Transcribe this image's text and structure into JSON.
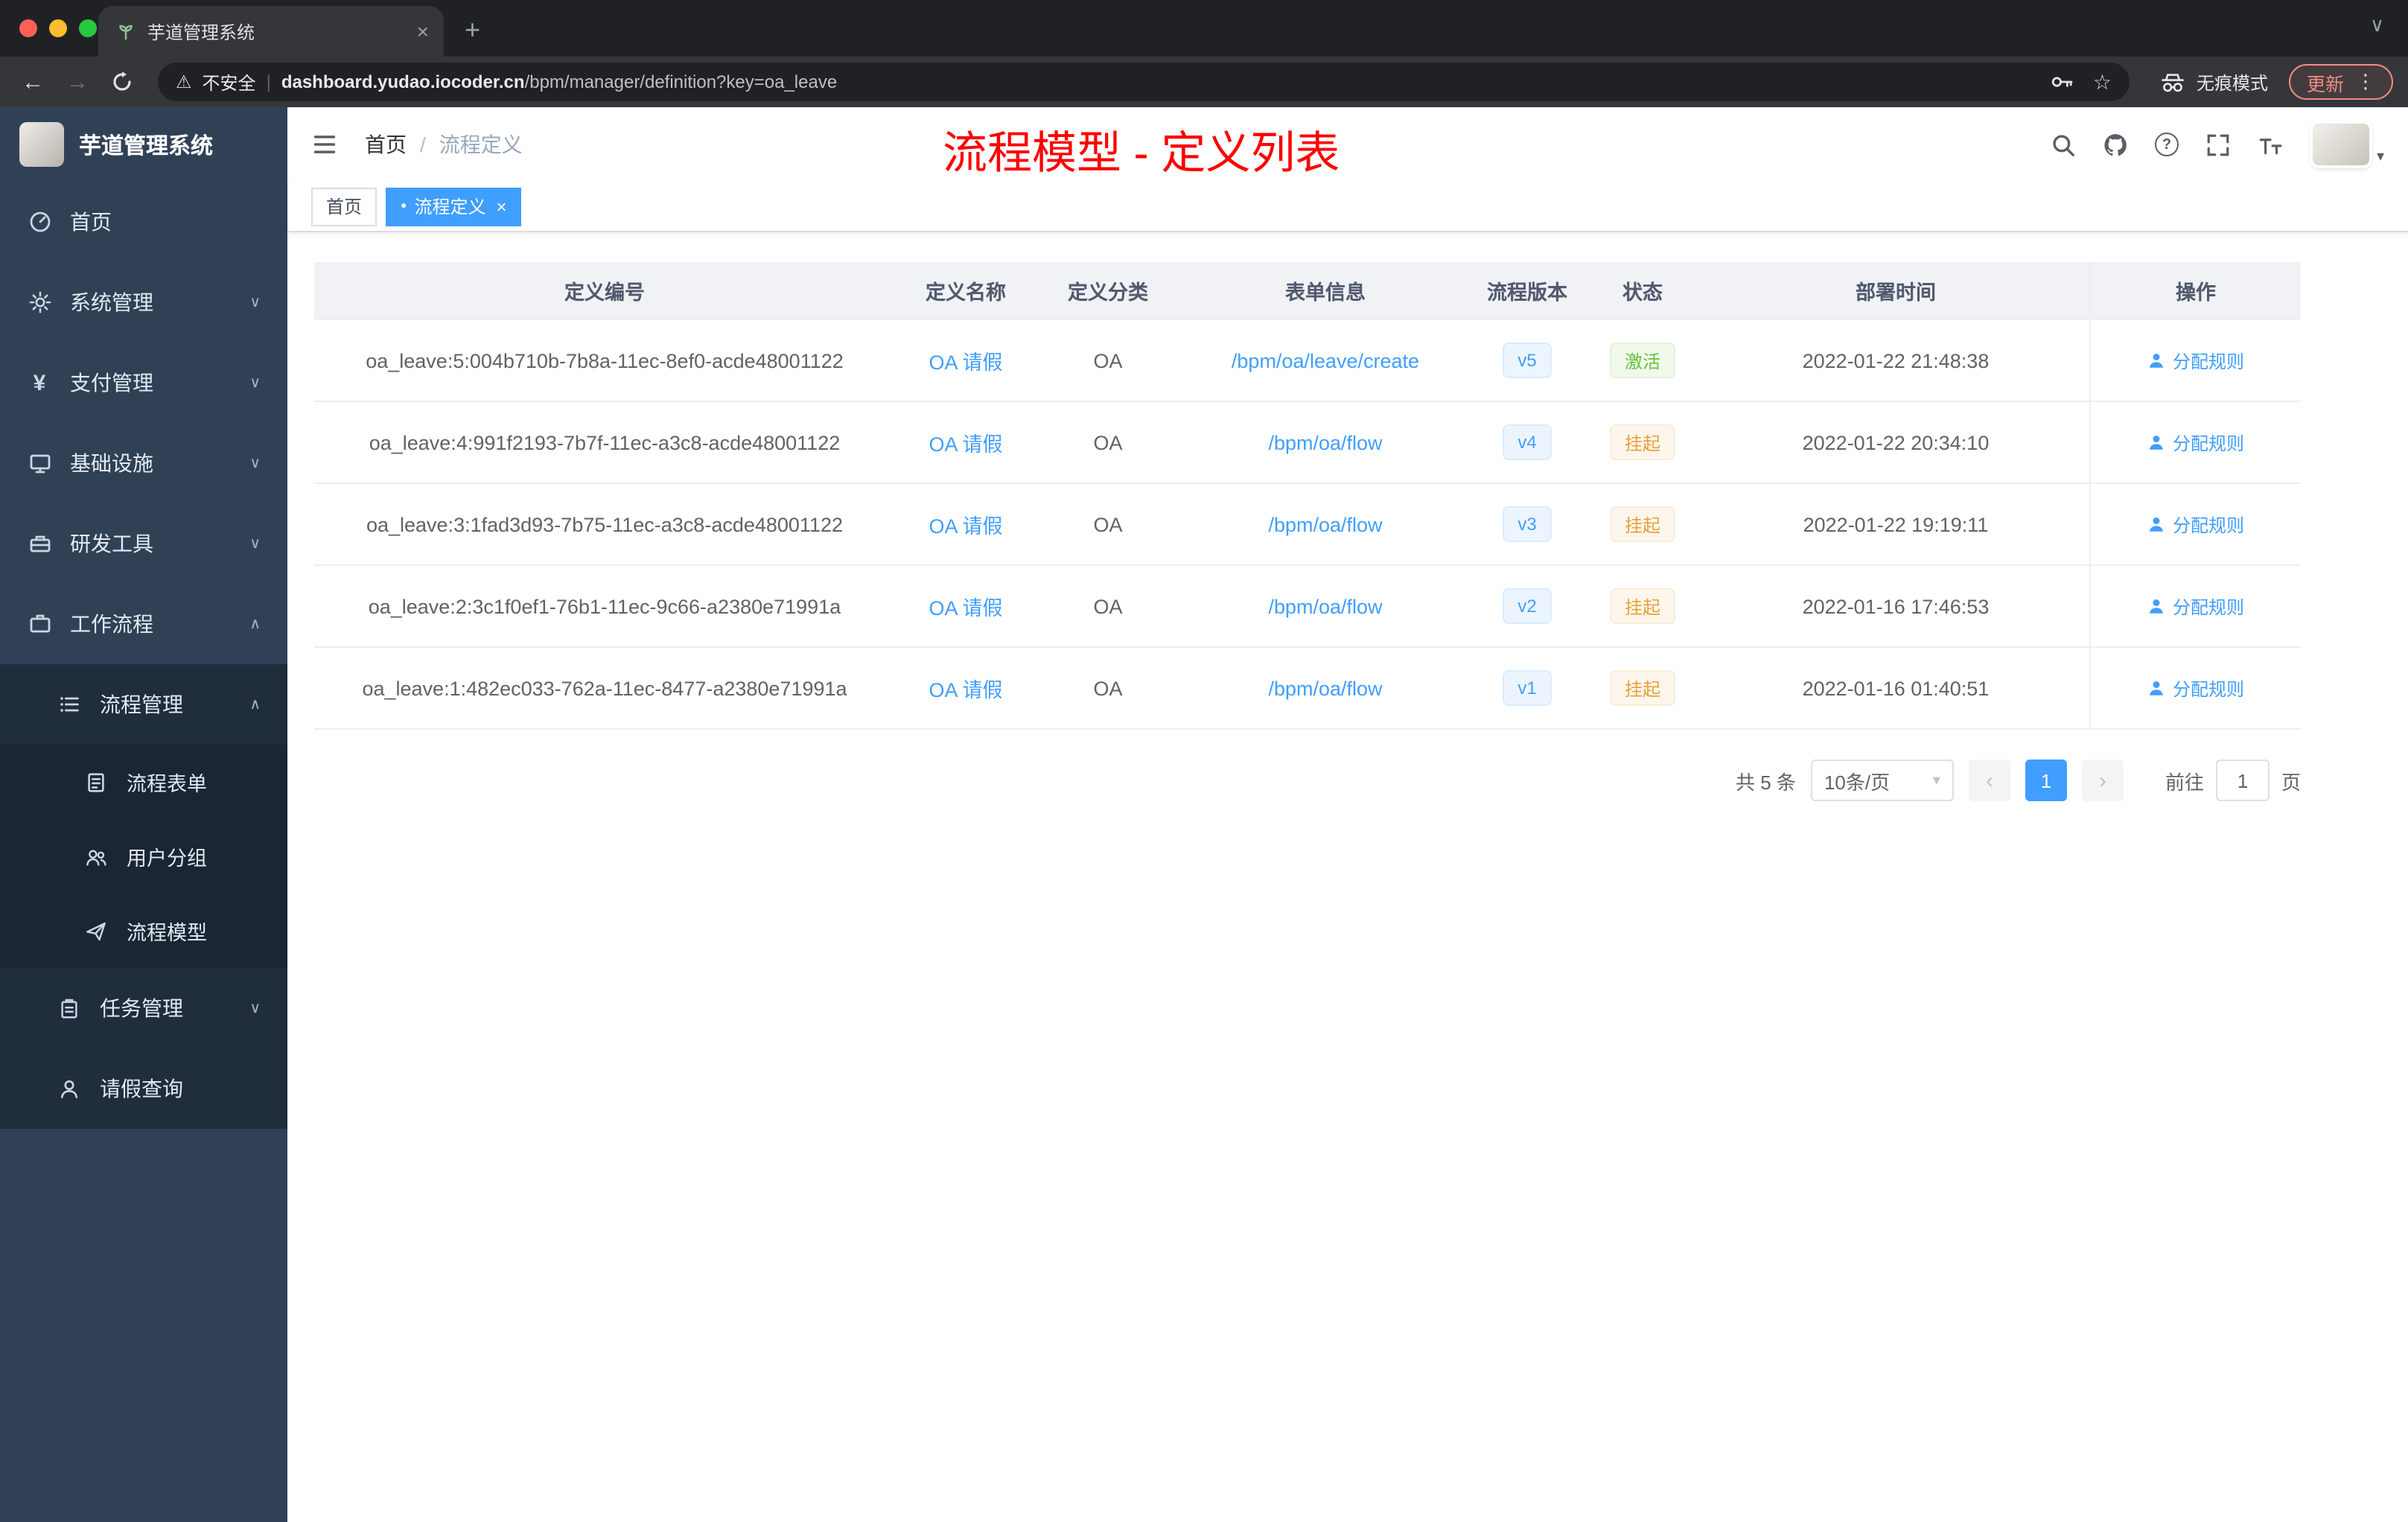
{
  "browser": {
    "tab_title": "芋道管理系统",
    "security_label": "不安全",
    "url_host": "dashboard.yudao.iocoder.cn",
    "url_path": "/bpm/manager/definition?key=oa_leave",
    "incognito_label": "无痕模式",
    "update_label": "更新"
  },
  "icons": {
    "back": "←",
    "forward": "→",
    "star": "☆",
    "warning": "⚠",
    "menu_dots": "⋮",
    "close": "×",
    "new_tab": "+",
    "tabs_chevron": "∨",
    "separator": "|",
    "avatar_caret": "▾",
    "select_caret": "▾",
    "pager_prev": "‹",
    "pager_next": "›",
    "breadcrumb_sep": "/",
    "tag_dot": "●",
    "yen": "¥",
    "chevron_down": "∨",
    "chevron_up": "∧"
  },
  "sidebar": {
    "logo_title": "芋道管理系统",
    "items": [
      {
        "label": "首页"
      },
      {
        "label": "系统管理"
      },
      {
        "label": "支付管理"
      },
      {
        "label": "基础设施"
      },
      {
        "label": "研发工具"
      },
      {
        "label": "工作流程"
      }
    ],
    "process_management": {
      "label": "流程管理"
    },
    "process_children": [
      {
        "label": "流程表单"
      },
      {
        "label": "用户分组"
      },
      {
        "label": "流程模型"
      }
    ],
    "task_management": {
      "label": "任务管理"
    },
    "leave_query": {
      "label": "请假查询"
    }
  },
  "header": {
    "breadcrumb_home": "首页",
    "breadcrumb_current": "流程定义",
    "annotation": "流程模型 - 定义列表"
  },
  "tags": [
    {
      "label": "首页"
    },
    {
      "label": "流程定义"
    }
  ],
  "table": {
    "headers": [
      "定义编号",
      "定义名称",
      "定义分类",
      "表单信息",
      "流程版本",
      "状态",
      "部署时间",
      "操作"
    ],
    "rows": [
      {
        "id": "oa_leave:5:004b710b-7b8a-11ec-8ef0-acde48001122",
        "name": "OA 请假",
        "category": "OA",
        "form": "/bpm/oa/leave/create",
        "version": "v5",
        "status": "激活",
        "deployed_at": "2022-01-22 21:48:38",
        "action": "分配规则"
      },
      {
        "id": "oa_leave:4:991f2193-7b7f-11ec-a3c8-acde48001122",
        "name": "OA 请假",
        "category": "OA",
        "form": "/bpm/oa/flow",
        "version": "v4",
        "status": "挂起",
        "deployed_at": "2022-01-22 20:34:10",
        "action": "分配规则"
      },
      {
        "id": "oa_leave:3:1fad3d93-7b75-11ec-a3c8-acde48001122",
        "name": "OA 请假",
        "category": "OA",
        "form": "/bpm/oa/flow",
        "version": "v3",
        "status": "挂起",
        "deployed_at": "2022-01-22 19:19:11",
        "action": "分配规则"
      },
      {
        "id": "oa_leave:2:3c1f0ef1-76b1-11ec-9c66-a2380e71991a",
        "name": "OA 请假",
        "category": "OA",
        "form": "/bpm/oa/flow",
        "version": "v2",
        "status": "挂起",
        "deployed_at": "2022-01-16 17:46:53",
        "action": "分配规则"
      },
      {
        "id": "oa_leave:1:482ec033-762a-11ec-8477-a2380e71991a",
        "name": "OA 请假",
        "category": "OA",
        "form": "/bpm/oa/flow",
        "version": "v1",
        "status": "挂起",
        "deployed_at": "2022-01-16 01:40:51",
        "action": "分配规则"
      }
    ]
  },
  "pagination": {
    "total": "共 5 条",
    "page_size": "10条/页",
    "current_page": "1",
    "goto_label": "前往",
    "goto_value": "1",
    "page_unit": "页"
  },
  "colors": {
    "accent": "#409eff",
    "status_active": "#67c23a",
    "status_suspended": "#e6a23c",
    "annotation_red": "#fe0000",
    "sidebar_bg": "#304156",
    "submenu_bg": "#1f2d3d"
  }
}
